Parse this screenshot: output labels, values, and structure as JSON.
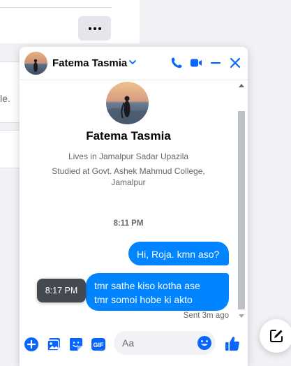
{
  "background": {
    "partial_text": "le."
  },
  "chat": {
    "header": {
      "name": "Fatema Tasmia"
    },
    "profile": {
      "name": "Fatema Tasmia",
      "lives_in": "Lives in Jamalpur Sadar Upazila",
      "studied_at_line1": "Studied at Govt. Ashek Mahmud College,",
      "studied_at_line2": "Jamalpur"
    },
    "time_divider": "8:11 PM",
    "messages": [
      {
        "text": "Hi, Roja. kmn aso?",
        "outgoing": true
      },
      {
        "line1": "tmr sathe kiso kotha ase",
        "line2": "tmr somoi hobe ki akto",
        "outgoing": true
      }
    ],
    "tooltip_time": "8:17 PM",
    "sent_status": "Sent 3m ago",
    "composer": {
      "placeholder": "Aa"
    }
  },
  "colors": {
    "accent": "#0084ff",
    "bubble_text": "#ffffff",
    "tooltip_bg": "#444950",
    "icon_blue": "#0866ff"
  },
  "icons": [
    "more-icon",
    "chevron-down-icon",
    "phone-icon",
    "video-icon",
    "minimize-icon",
    "close-icon",
    "plus-icon",
    "image-icon",
    "sticker-icon",
    "gif-icon",
    "emoji-icon",
    "like-icon",
    "compose-icon"
  ]
}
